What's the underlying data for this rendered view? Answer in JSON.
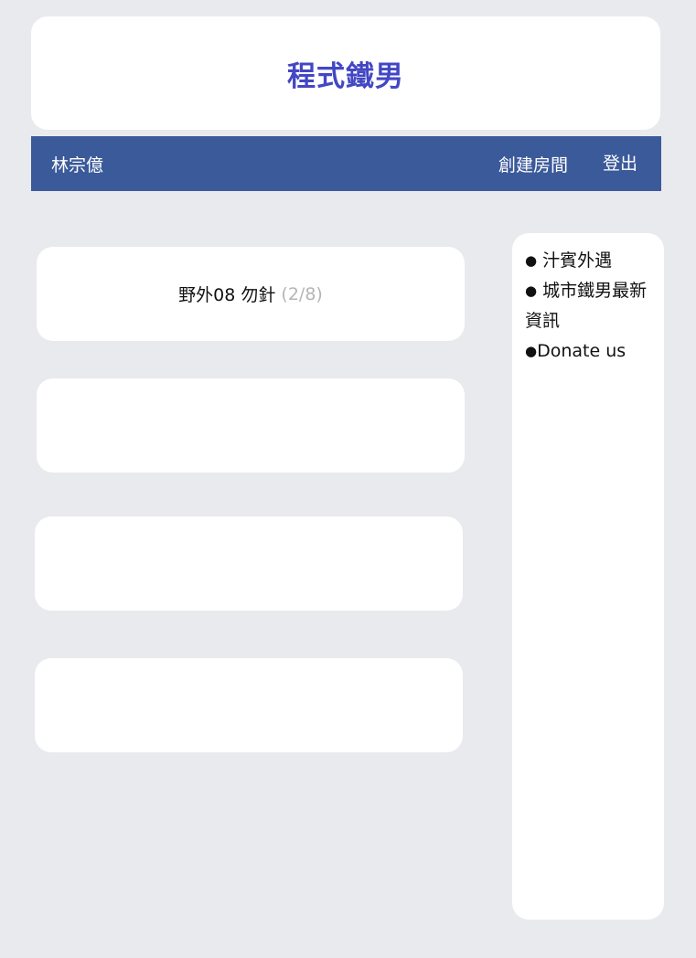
{
  "header": {
    "site_title": "程式鐵男"
  },
  "navbar": {
    "user_name": "林宗億",
    "create_room_label": "創建房間",
    "logout_label": "登出"
  },
  "rooms": [
    {
      "name": "野外08 勿針",
      "count": "(2/8)"
    },
    {
      "name": "",
      "count": ""
    },
    {
      "name": "",
      "count": ""
    },
    {
      "name": "",
      "count": ""
    }
  ],
  "sidebar": {
    "bullet": "●",
    "links": [
      {
        "label": " 汁賓外遇"
      },
      {
        "label": " 城市鐵男最新資訊"
      },
      {
        "label": "Donate us"
      }
    ]
  }
}
